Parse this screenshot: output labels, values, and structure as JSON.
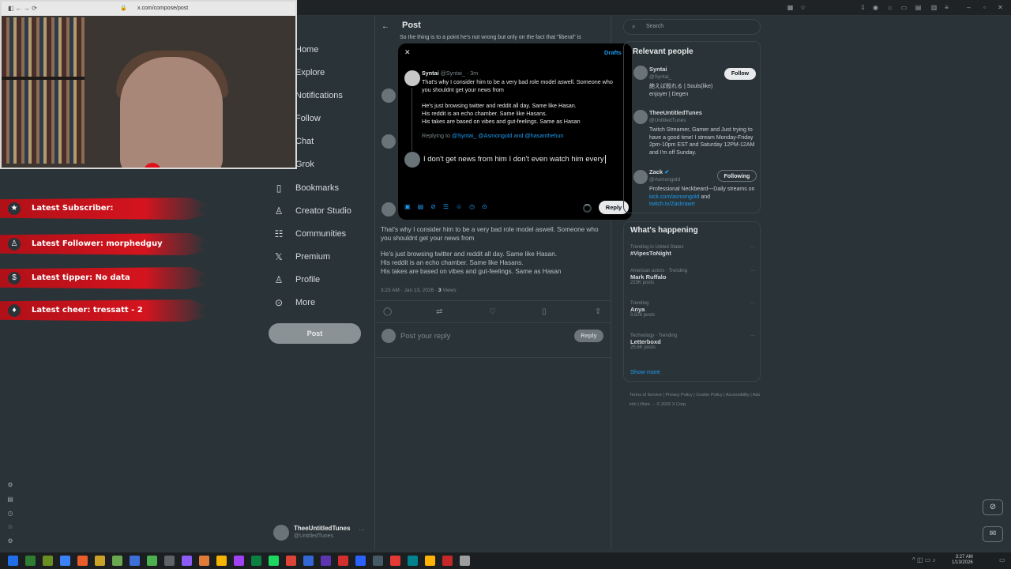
{
  "browser": {
    "url": "x.com/compose/post"
  },
  "stream_overlay": {
    "banners": [
      {
        "icon": "star-icon",
        "text": "Latest Subscriber:"
      },
      {
        "icon": "user-icon",
        "text": "Latest Follower: morphedguy"
      },
      {
        "icon": "dollar-icon",
        "text": "Latest tipper: No data"
      },
      {
        "icon": "diamond-icon",
        "text": "Latest cheer: tressatt - 2"
      }
    ]
  },
  "nav": {
    "items": [
      {
        "icon": "home-icon",
        "label": "Home"
      },
      {
        "icon": "search-icon",
        "label": "Explore"
      },
      {
        "icon": "bell-icon",
        "label": "Notifications"
      },
      {
        "icon": "follow-icon",
        "label": "Follow"
      },
      {
        "icon": "chat-icon",
        "label": "Chat"
      },
      {
        "icon": "grok-icon",
        "label": "Grok"
      },
      {
        "icon": "bookmark-icon",
        "label": "Bookmarks"
      },
      {
        "icon": "creator-icon",
        "label": "Creator Studio"
      },
      {
        "icon": "communities-icon",
        "label": "Communities"
      },
      {
        "icon": "x-icon",
        "label": "Premium"
      },
      {
        "icon": "profile-icon",
        "label": "Profile"
      },
      {
        "icon": "more-icon",
        "label": "More"
      }
    ],
    "post_label": "Post",
    "account": {
      "name": "TheeUntitledTunes",
      "handle": "@UntitledTunes"
    }
  },
  "main": {
    "title": "Post",
    "partial_text": "So the thing is to a point he's not wrong but only on the fact that \"liberal\" is",
    "post_body": [
      "That's why I consider him to be a very bad role model aswell. Someone who you shouldnt get your news from",
      "He's just browsing twitter and reddit all day. Same like Hasan.",
      "His reddit is an echo chamber. Same like Hasans.",
      "His takes are based on vibes and gut-feelings. Same as Hasan"
    ],
    "timestamp": "3:23 AM · Jan 13, 2026 · ",
    "views_count": "3",
    "views_label": " Views",
    "reply_placeholder": "Post your reply",
    "reply_label": "Reply"
  },
  "modal": {
    "drafts_label": "Drafts",
    "author_name": "Syntai",
    "author_handle": "@Syntai_ · 3m",
    "quoted_lines": [
      "That's why I consider him to be a very bad role model aswell. Someone who",
      "you shouldnt get your news from",
      "He's just browsing twitter and reddit all day. Same like Hasan.",
      "His reddit is an echo chamber. Same like Hasans.",
      "His takes are based on vibes and gut-feelings. Same as Hasan"
    ],
    "replying_to_label": "Replying to ",
    "replying_to_users": "@Syntai_ @Asmongold and @hasanthehun",
    "draft_text": "I don't get news from him I don't even watch him every",
    "reply_label": "Reply"
  },
  "right": {
    "search_placeholder": "Search",
    "relevant_title": "Relevant people",
    "people": [
      {
        "name": "Syntai",
        "handle": "@Syntai_",
        "bio": "絶えば殺れる | Souls(like) enjoyer | Degen",
        "button": "Follow"
      },
      {
        "name": "TheeUntitledTunes",
        "handle": "@UntitledTunes",
        "bio": "Twitch Streamer, Gamer and Just trying to have a good time! I stream Monday-Friday 2pm-10pm EST and Saturday 12PM-12AM and I'm off Sunday.",
        "button": ""
      },
      {
        "name": "Zack",
        "handle": "@Asmongold",
        "bio_prefix": "Professional Neckbeard---Daily streams on ",
        "bio_link1": "kick.com/asmongold",
        "bio_mid": " and ",
        "bio_link2": "twitch.tv/Zackrawrr",
        "button": "Following"
      }
    ],
    "happening_title": "What's happening",
    "trends": [
      {
        "meta": "Trending in United States",
        "name": "#VipesToNight",
        "count": ""
      },
      {
        "meta": "American actors · Trending",
        "name": "Mark Ruffalo",
        "count": "223K posts"
      },
      {
        "meta": "Trending",
        "name": "Anya",
        "count": "9,826 posts"
      },
      {
        "meta": "Technology · Trending",
        "name": "Letterboxd",
        "count": "25.6K posts"
      }
    ],
    "show_more": "Show more",
    "footer": [
      "Terms of Service",
      "Privacy Policy",
      "Cookie Policy",
      "Accessibility",
      "Ads info",
      "More ···",
      "© 2026 X Corp."
    ]
  },
  "taskbar": {
    "time": "3:27 AM",
    "date": "1/13/2026"
  }
}
